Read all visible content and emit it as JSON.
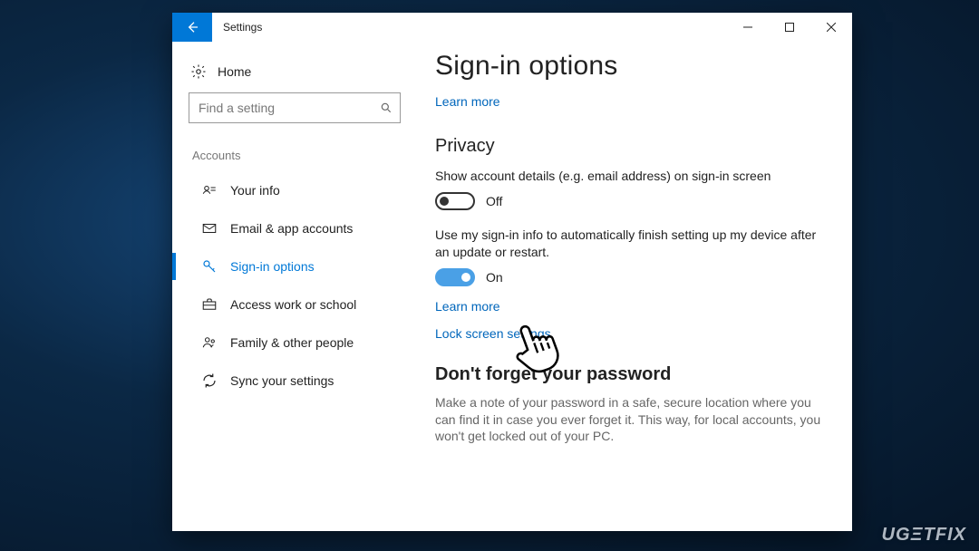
{
  "app": {
    "title": "Settings"
  },
  "sidebar": {
    "home_label": "Home",
    "search_placeholder": "Find a setting",
    "section_label": "Accounts",
    "items": [
      {
        "label": "Your info"
      },
      {
        "label": "Email & app accounts"
      },
      {
        "label": "Sign-in options"
      },
      {
        "label": "Access work or school"
      },
      {
        "label": "Family & other people"
      },
      {
        "label": "Sync your settings"
      }
    ]
  },
  "main": {
    "page_title": "Sign-in options",
    "learn_more": "Learn more",
    "privacy_heading": "Privacy",
    "privacy_setting1": "Show account details (e.g. email address) on sign-in screen",
    "privacy_toggle1_label": "Off",
    "privacy_setting2": "Use my sign-in info to automatically finish setting up my device after an update or restart.",
    "privacy_toggle2_label": "On",
    "learn_more2": "Learn more",
    "lock_screen_link": "Lock screen settings",
    "forget_heading": "Don't forget your password",
    "forget_body": "Make a note of your password in a safe, secure location where you can find it in case you ever forget it. This way, for local accounts, you won't get locked out of your PC."
  },
  "watermark": "UGΞTFIX"
}
